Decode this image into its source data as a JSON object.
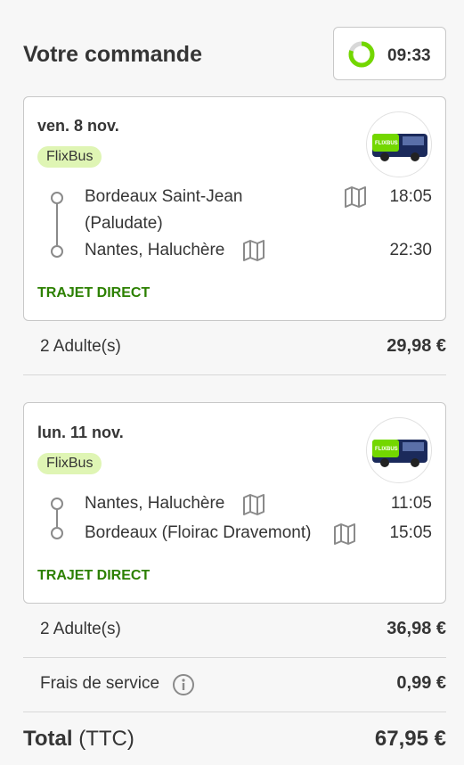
{
  "header": {
    "title": "Votre commande",
    "timer": "09:33",
    "timer_fraction_remaining": 0.8,
    "timer_color": "#73d700"
  },
  "trips": [
    {
      "date": "ven. 8 nov.",
      "operator": "FlixBus",
      "logo_text": "FLIXBUS",
      "departure": {
        "name_line1": "Bordeaux Saint-Jean",
        "name_line2": "(Paludate)",
        "time": "18:05"
      },
      "arrival": {
        "name": "Nantes, Haluchère",
        "time": "22:30"
      },
      "tag": "TRAJET DIRECT"
    },
    {
      "date": "lun. 11 nov.",
      "operator": "FlixBus",
      "logo_text": "FLIXBUS",
      "departure": {
        "name": "Nantes, Haluchère",
        "time": "11:05"
      },
      "arrival": {
        "name": "Bordeaux (Floirac Dravemont)",
        "time": "15:05"
      },
      "tag": "TRAJET DIRECT"
    }
  ],
  "prices": {
    "trip1_label": "2 Adulte(s)",
    "trip1_value": "29,98 €",
    "trip2_label": "2 Adulte(s)",
    "trip2_value": "36,98 €",
    "service_label": "Frais de service",
    "service_value": "0,99 €"
  },
  "total": {
    "label_bold": "Total",
    "label_suffix": "(TTC)",
    "value": "67,95 €"
  },
  "colors": {
    "badge_bg": "#dff5b4",
    "direct_green": "#2c8000",
    "brand_green": "#73d700",
    "bus_navy": "#1b2a5b"
  },
  "icons": [
    "timer-ring-icon",
    "map-icon",
    "info-icon",
    "bus-logo"
  ]
}
